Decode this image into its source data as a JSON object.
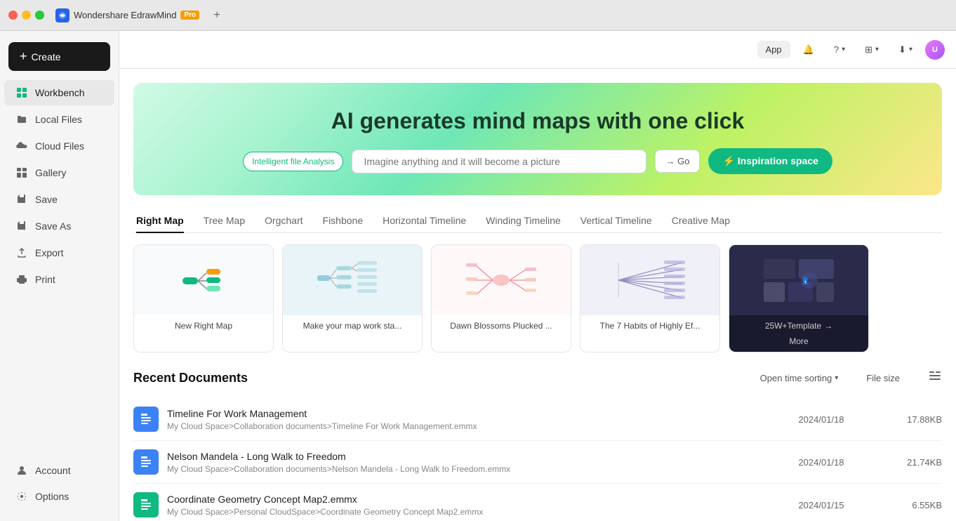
{
  "titlebar": {
    "app_name": "Wondershare EdrawMind",
    "pro_label": "Pro",
    "new_tab_icon": "+"
  },
  "header_toolbar": {
    "app_btn_label": "App",
    "avatar_initials": "U"
  },
  "sidebar": {
    "create_label": "Create",
    "items": [
      {
        "id": "workbench",
        "label": "Workbench",
        "icon": "workbench",
        "active": true
      },
      {
        "id": "local-files",
        "label": "Local Files",
        "icon": "local-files",
        "active": false
      },
      {
        "id": "cloud-files",
        "label": "Cloud Files",
        "icon": "cloud-files",
        "active": false
      },
      {
        "id": "gallery",
        "label": "Gallery",
        "icon": "gallery",
        "active": false
      },
      {
        "id": "save",
        "label": "Save",
        "icon": "save",
        "active": false
      },
      {
        "id": "save-as",
        "label": "Save As",
        "icon": "save-as",
        "active": false
      },
      {
        "id": "export",
        "label": "Export",
        "icon": "export",
        "active": false
      },
      {
        "id": "print",
        "label": "Print",
        "icon": "print",
        "active": false
      }
    ],
    "bottom_items": [
      {
        "id": "account",
        "label": "Account",
        "icon": "account"
      },
      {
        "id": "options",
        "label": "Options",
        "icon": "options"
      }
    ]
  },
  "banner": {
    "title": "AI generates mind maps with one click",
    "tag_label": "Intelligent file Analysis",
    "input_placeholder": "Imagine anything and it will become a picture",
    "go_label": "→ Go",
    "inspiration_label": "⚡ Inspiration space"
  },
  "templates": {
    "tabs": [
      {
        "id": "right-map",
        "label": "Right Map",
        "active": true
      },
      {
        "id": "tree-map",
        "label": "Tree Map",
        "active": false
      },
      {
        "id": "orgchart",
        "label": "Orgchart",
        "active": false
      },
      {
        "id": "fishbone",
        "label": "Fishbone",
        "active": false
      },
      {
        "id": "horizontal-timeline",
        "label": "Horizontal Timeline",
        "active": false
      },
      {
        "id": "winding-timeline",
        "label": "Winding Timeline",
        "active": false
      },
      {
        "id": "vertical-timeline",
        "label": "Vertical Timeline",
        "active": false
      },
      {
        "id": "creative-map",
        "label": "Creative Map",
        "active": false
      }
    ],
    "cards": [
      {
        "id": "new-right-map",
        "label": "New Right Map",
        "type": "blank"
      },
      {
        "id": "map-work",
        "label": "Make your map work sta...",
        "type": "preview"
      },
      {
        "id": "dawn-blossoms",
        "label": "Dawn Blossoms Plucked ...",
        "type": "preview"
      },
      {
        "id": "seven-habits",
        "label": "The 7 Habits of Highly Ef...",
        "type": "preview"
      }
    ],
    "more_label": "25W+Template",
    "more_card_label": "More"
  },
  "recent_docs": {
    "title": "Recent Documents",
    "sort_label": "Open time sorting",
    "filesize_col": "File size",
    "items": [
      {
        "name": "Timeline For Work Management",
        "path": "My Cloud Space>Collaboration documents>Timeline For Work Management.emmx",
        "date": "2024/01/18",
        "size": "17.88KB",
        "icon_color": "blue"
      },
      {
        "name": "Nelson Mandela - Long Walk to Freedom",
        "path": "My Cloud Space>Collaboration documents>Nelson Mandela - Long Walk to Freedom.emmx",
        "date": "2024/01/18",
        "size": "21.74KB",
        "icon_color": "blue"
      },
      {
        "name": "Coordinate Geometry Concept Map2.emmx",
        "path": "My Cloud Space>Personal CloudSpace>Coordinate Geometry Concept Map2.emmx",
        "date": "2024/01/15",
        "size": "6.55KB",
        "icon_color": "green"
      }
    ]
  }
}
